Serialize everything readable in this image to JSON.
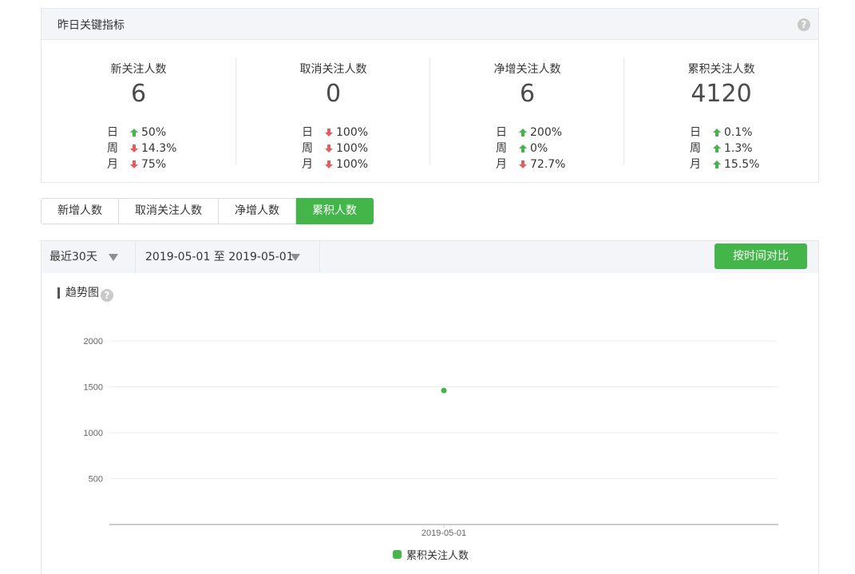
{
  "kpi": {
    "title": "昨日关键指标",
    "help": "?",
    "items": [
      {
        "label": "新关注人数",
        "value": "6",
        "changes": [
          {
            "period": "日",
            "dir": "up",
            "value": "50%"
          },
          {
            "period": "周",
            "dir": "down",
            "value": "14.3%"
          },
          {
            "period": "月",
            "dir": "down",
            "value": "75%"
          }
        ]
      },
      {
        "label": "取消关注人数",
        "value": "0",
        "changes": [
          {
            "period": "日",
            "dir": "down",
            "value": "100%"
          },
          {
            "period": "周",
            "dir": "down",
            "value": "100%"
          },
          {
            "period": "月",
            "dir": "down",
            "value": "100%"
          }
        ]
      },
      {
        "label": "净增关注人数",
        "value": "6",
        "changes": [
          {
            "period": "日",
            "dir": "up",
            "value": "200%"
          },
          {
            "period": "周",
            "dir": "up",
            "value": "0%"
          },
          {
            "period": "月",
            "dir": "down",
            "value": "72.7%"
          }
        ]
      },
      {
        "label": "累积关注人数",
        "value": "4120",
        "changes": [
          {
            "period": "日",
            "dir": "up",
            "value": "0.1%"
          },
          {
            "period": "周",
            "dir": "up",
            "value": "1.3%"
          },
          {
            "period": "月",
            "dir": "up",
            "value": "15.5%"
          }
        ]
      }
    ]
  },
  "tabs": [
    {
      "label": "新增人数",
      "active": false
    },
    {
      "label": "取消关注人数",
      "active": false
    },
    {
      "label": "净增人数",
      "active": false
    },
    {
      "label": "累积人数",
      "active": true
    }
  ],
  "filter": {
    "range": "最近30天",
    "dates": "2019-05-01 至 2019-05-01",
    "compare_button": "按时间对比"
  },
  "trend": {
    "title": "趋势图",
    "help": "?"
  },
  "colors": {
    "accent": "#44b549",
    "up": "#44b549",
    "down": "#e15f63"
  },
  "chart_data": {
    "type": "line",
    "x": [
      "2019-05-01"
    ],
    "series": [
      {
        "name": "累积关注人数",
        "values": [
          1460
        ]
      }
    ],
    "ylim": [
      0,
      2000
    ],
    "yticks": [
      500,
      1000,
      1500,
      2000
    ],
    "grid": true,
    "legend": "bottom"
  }
}
